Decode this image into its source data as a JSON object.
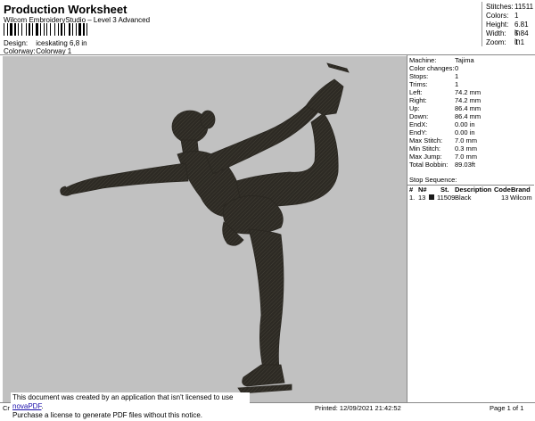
{
  "header": {
    "title": "Production Worksheet",
    "subtitle": "Wilcom EmbroideryStudio – Level 3 Advanced",
    "design_label": "Design:",
    "design_value": "iceskating 6,8 in",
    "colorway_label": "Colorway:",
    "colorway_value": "Colorway 1"
  },
  "stats": [
    {
      "label": "Stitches:",
      "value": "11511"
    },
    {
      "label": "Colors:",
      "value": "1"
    },
    {
      "label": "Height:",
      "value": "6.81 in"
    },
    {
      "label": "Width:",
      "value": "5.84 in"
    },
    {
      "label": "Zoom:",
      "value": "1:1"
    }
  ],
  "properties": [
    {
      "label": "Machine:",
      "value": "Tajima"
    },
    {
      "label": "Color changes:",
      "value": "0"
    },
    {
      "label": "Stops:",
      "value": "1"
    },
    {
      "label": "Trims:",
      "value": "1"
    },
    {
      "label": "Left:",
      "value": "74.2 mm"
    },
    {
      "label": "Right:",
      "value": "74.2 mm"
    },
    {
      "label": "Up:",
      "value": "86.4 mm"
    },
    {
      "label": "Down:",
      "value": "86.4 mm"
    },
    {
      "label": "EndX:",
      "value": "0.00 in"
    },
    {
      "label": "EndY:",
      "value": "0.00 in"
    },
    {
      "label": "Max Stitch:",
      "value": "7.0 mm"
    },
    {
      "label": "Min Stitch:",
      "value": "0.3 mm"
    },
    {
      "label": "Max Jump:",
      "value": "7.0 mm"
    },
    {
      "label": "Total Bobbin:",
      "value": "89.03ft"
    }
  ],
  "stop_sequence": {
    "title": "Stop Sequence:",
    "headers": [
      "#",
      "N#",
      "St.",
      "Description",
      "Code",
      "Brand"
    ],
    "rows": [
      {
        "num": "1.",
        "n": "13",
        "swatch_color": "#1a1a1a",
        "st": "11509",
        "description": "Black",
        "code": "13",
        "brand": "Wilcom"
      }
    ]
  },
  "notice": {
    "line1": "This document was created by an application that isn't licensed to use ",
    "link": "novaPDF",
    "line1_end": ".",
    "line2": "Purchase a license to generate PDF files without this notice."
  },
  "footer": {
    "left": "Cr",
    "printed": "Printed: 12/09/2021 21:42:52",
    "page": "Page 1 of 1"
  },
  "colors": {
    "preview_bg": "#c1c1c1",
    "figure": "#2d2a24"
  }
}
